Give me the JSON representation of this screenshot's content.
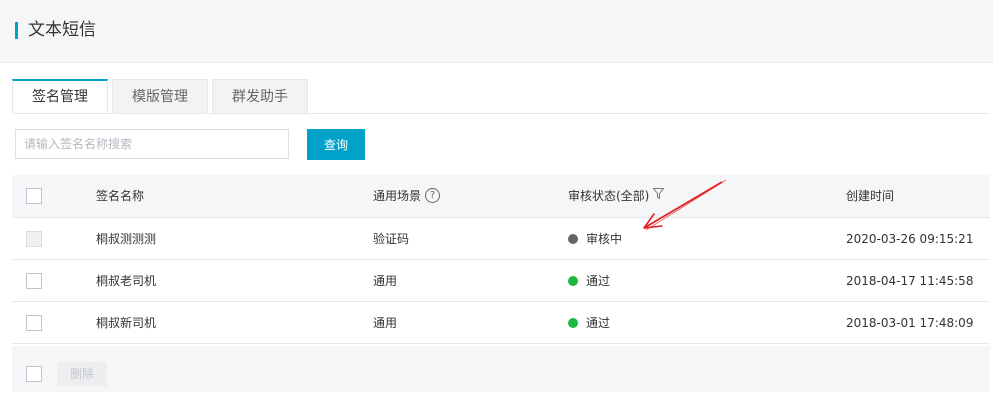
{
  "header": {
    "title": "文本短信"
  },
  "tabs": [
    {
      "label": "签名管理",
      "active": true
    },
    {
      "label": "模版管理",
      "active": false
    },
    {
      "label": "群发助手",
      "active": false
    }
  ],
  "search": {
    "placeholder": "请输入签名名称搜索",
    "value": "",
    "button_label": "查询"
  },
  "table": {
    "columns": {
      "name": "签名名称",
      "scene": "通用场景",
      "scene_help_icon": "help-icon",
      "status": "审核状态(全部)",
      "status_filter_icon": "filter-icon",
      "time": "创建时间"
    },
    "rows": [
      {
        "name": "桐叔测测测",
        "scene": "验证码",
        "status": "审核中",
        "status_color": "#666666",
        "time": "2020-03-26 09:15:21",
        "checkbox_disabled": true
      },
      {
        "name": "桐叔老司机",
        "scene": "通用",
        "status": "通过",
        "status_color": "#1db83f",
        "time": "2018-04-17 11:45:58",
        "checkbox_disabled": false
      },
      {
        "name": "桐叔新司机",
        "scene": "通用",
        "status": "通过",
        "status_color": "#1db83f",
        "time": "2018-03-01 17:48:09",
        "checkbox_disabled": false
      }
    ]
  },
  "footer": {
    "delete_label": "删除"
  },
  "colors": {
    "accent": "#00a2ca",
    "annotation_arrow": "#e02020"
  }
}
